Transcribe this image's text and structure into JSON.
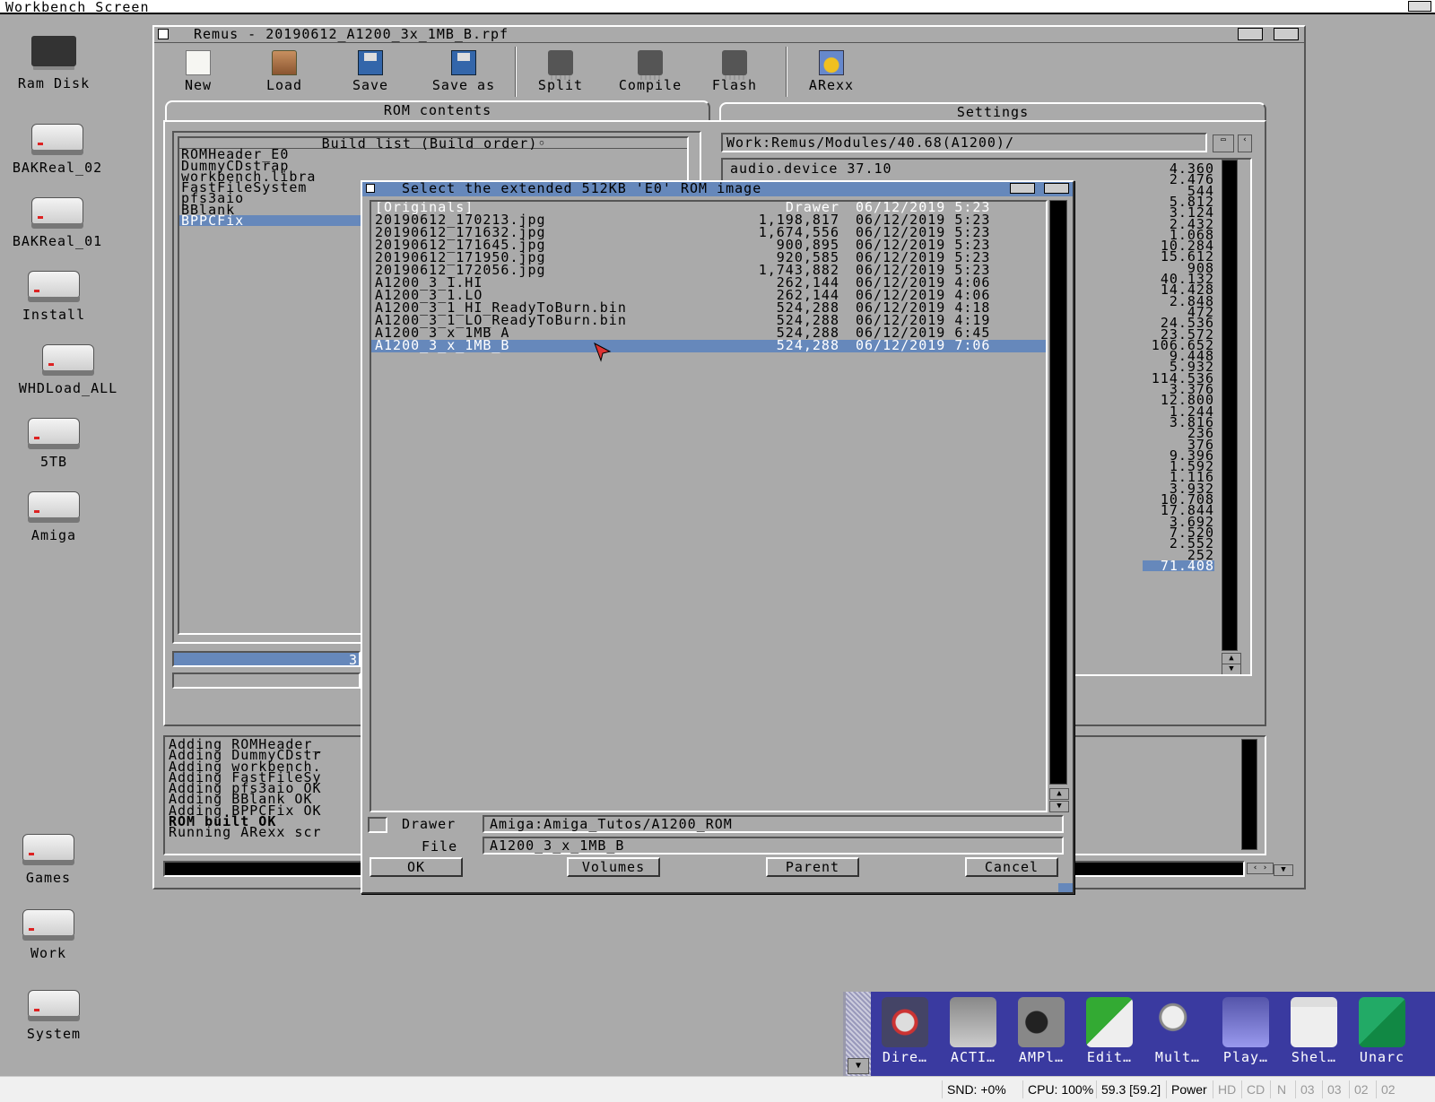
{
  "screen": {
    "title": "Workbench Screen"
  },
  "desktop_icons": [
    {
      "label": "Ram Disk"
    },
    {
      "label": "BAKReal_02"
    },
    {
      "label": "BAKReal_01"
    },
    {
      "label": "Install"
    },
    {
      "label": "WHDLoad_ALL"
    },
    {
      "label": "5TB"
    },
    {
      "label": "Amiga"
    },
    {
      "label": "Games"
    },
    {
      "label": "Work"
    },
    {
      "label": "System"
    }
  ],
  "main_window": {
    "title": "Remus - 20190612_A1200_3x_1MB_B.rpf",
    "toolbar": [
      "New",
      "Load",
      "Save",
      "Save as",
      "Split",
      "Compile",
      "Flash",
      "ARexx"
    ],
    "tabs": [
      "ROM contents",
      "Settings"
    ],
    "build_list": {
      "header": "Build list (Build order)",
      "items": [
        "ROMHeader_E0",
        "DummyCDstrap",
        "workbench.libra",
        "FastFileSystem",
        "pfs3aio",
        "BBlank",
        "BPPCFix"
      ],
      "selected_index": 6,
      "gauge_text": "3"
    },
    "modules": {
      "path": "Work:Remus/Modules/40.68(A1200)/",
      "first_item": "audio.device 37.10",
      "values": [
        "4.360",
        "2.476",
        "544",
        "5.812",
        "3.124",
        "2.432",
        "1.068",
        "10.284",
        "15.612",
        "908",
        "40.132",
        "14.428",
        "2.848",
        "472",
        "24.536",
        "23.572",
        "106.652",
        "9.448",
        "5.932",
        "114.536",
        "3.376",
        "12.800",
        "1.244",
        "3.816",
        "236",
        "376",
        "9.396",
        "1.592",
        "1.116",
        "3.932",
        "10.708",
        "17.844",
        "3.692",
        "7.520",
        "2.552",
        "252",
        "71.408"
      ],
      "selected_index": 36
    },
    "log": [
      {
        "text": "Adding ROMHeader_",
        "bold": false
      },
      {
        "text": "Adding DummyCDstr",
        "bold": false
      },
      {
        "text": "Adding workbench.",
        "bold": false
      },
      {
        "text": "Adding FastFileSy",
        "bold": false
      },
      {
        "text": "Adding pfs3aio OK",
        "bold": false
      },
      {
        "text": "Adding BBlank OK",
        "bold": false
      },
      {
        "text": "Adding BPPCFix OK",
        "bold": false
      },
      {
        "text": "ROM built OK",
        "bold": true
      },
      {
        "text": "Running ARexx scr",
        "bold": false
      }
    ]
  },
  "requester": {
    "title": "Select the extended 512KB 'E0' ROM image",
    "files": [
      {
        "name": "[Originals]",
        "size": "Drawer",
        "date": "06/12/2019 5:23",
        "drawer": true
      },
      {
        "name": "20190612_170213.jpg",
        "size": "1,198,817",
        "date": "06/12/2019 5:23"
      },
      {
        "name": "20190612_171632.jpg",
        "size": "1,674,556",
        "date": "06/12/2019 5:23"
      },
      {
        "name": "20190612_171645.jpg",
        "size": "900,895",
        "date": "06/12/2019 5:23"
      },
      {
        "name": "20190612_171950.jpg",
        "size": "920,585",
        "date": "06/12/2019 5:23"
      },
      {
        "name": "20190612_172056.jpg",
        "size": "1,743,882",
        "date": "06/12/2019 5:23"
      },
      {
        "name": "A1200_3_1.HI",
        "size": "262,144",
        "date": "06/12/2019 4:06"
      },
      {
        "name": "A1200_3_1.LO",
        "size": "262,144",
        "date": "06/12/2019 4:06"
      },
      {
        "name": "A1200_3_1_HI_ReadyToBurn.bin",
        "size": "524,288",
        "date": "06/12/2019 4:18"
      },
      {
        "name": "A1200_3_1_LO_ReadyToBurn.bin",
        "size": "524,288",
        "date": "06/12/2019 4:19"
      },
      {
        "name": "A1200_3_x_1MB_A",
        "size": "524,288",
        "date": "06/12/2019 6:45"
      },
      {
        "name": "A1200_3_x_1MB_B",
        "size": "524,288",
        "date": "06/12/2019 7:06",
        "selected": true
      }
    ],
    "drawer_label": "Drawer",
    "drawer_value": "Amiga:Amiga_Tutos/A1200_ROM",
    "file_label": "File",
    "file_value": "A1200_3_x_1MB_B",
    "buttons": {
      "ok": "OK",
      "volumes": "Volumes",
      "parent": "Parent",
      "cancel": "Cancel"
    }
  },
  "dock": [
    "Dire…",
    "ACTI…",
    "AMPl…",
    "Edit…",
    "Mult…",
    "Play…",
    "Shel…",
    "Unarc"
  ],
  "status_bar": {
    "snd": "SND: +0%",
    "cpu": "CPU: 100%",
    "fps": "59.3 [59.2]",
    "power": "Power",
    "hd": "HD",
    "cd": "CD",
    "n": "N",
    "d1": "03",
    "d2": "03",
    "d3": "02",
    "d4": "02"
  },
  "colors": {
    "workbench_grey": "#aaaaaa",
    "select_blue": "#6688bb",
    "dock_blue": "#3a3aa0"
  }
}
